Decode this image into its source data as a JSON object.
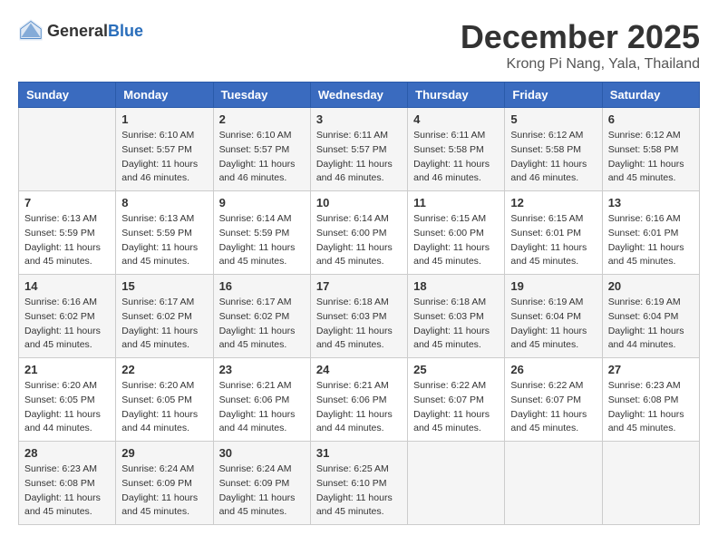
{
  "header": {
    "logo_general": "General",
    "logo_blue": "Blue",
    "month_title": "December 2025",
    "location": "Krong Pi Nang, Yala, Thailand"
  },
  "days_of_week": [
    "Sunday",
    "Monday",
    "Tuesday",
    "Wednesday",
    "Thursday",
    "Friday",
    "Saturday"
  ],
  "weeks": [
    [
      {
        "day": "",
        "info": ""
      },
      {
        "day": "1",
        "info": "Sunrise: 6:10 AM\nSunset: 5:57 PM\nDaylight: 11 hours\nand 46 minutes."
      },
      {
        "day": "2",
        "info": "Sunrise: 6:10 AM\nSunset: 5:57 PM\nDaylight: 11 hours\nand 46 minutes."
      },
      {
        "day": "3",
        "info": "Sunrise: 6:11 AM\nSunset: 5:57 PM\nDaylight: 11 hours\nand 46 minutes."
      },
      {
        "day": "4",
        "info": "Sunrise: 6:11 AM\nSunset: 5:58 PM\nDaylight: 11 hours\nand 46 minutes."
      },
      {
        "day": "5",
        "info": "Sunrise: 6:12 AM\nSunset: 5:58 PM\nDaylight: 11 hours\nand 46 minutes."
      },
      {
        "day": "6",
        "info": "Sunrise: 6:12 AM\nSunset: 5:58 PM\nDaylight: 11 hours\nand 45 minutes."
      }
    ],
    [
      {
        "day": "7",
        "info": "Sunrise: 6:13 AM\nSunset: 5:59 PM\nDaylight: 11 hours\nand 45 minutes."
      },
      {
        "day": "8",
        "info": "Sunrise: 6:13 AM\nSunset: 5:59 PM\nDaylight: 11 hours\nand 45 minutes."
      },
      {
        "day": "9",
        "info": "Sunrise: 6:14 AM\nSunset: 5:59 PM\nDaylight: 11 hours\nand 45 minutes."
      },
      {
        "day": "10",
        "info": "Sunrise: 6:14 AM\nSunset: 6:00 PM\nDaylight: 11 hours\nand 45 minutes."
      },
      {
        "day": "11",
        "info": "Sunrise: 6:15 AM\nSunset: 6:00 PM\nDaylight: 11 hours\nand 45 minutes."
      },
      {
        "day": "12",
        "info": "Sunrise: 6:15 AM\nSunset: 6:01 PM\nDaylight: 11 hours\nand 45 minutes."
      },
      {
        "day": "13",
        "info": "Sunrise: 6:16 AM\nSunset: 6:01 PM\nDaylight: 11 hours\nand 45 minutes."
      }
    ],
    [
      {
        "day": "14",
        "info": "Sunrise: 6:16 AM\nSunset: 6:02 PM\nDaylight: 11 hours\nand 45 minutes."
      },
      {
        "day": "15",
        "info": "Sunrise: 6:17 AM\nSunset: 6:02 PM\nDaylight: 11 hours\nand 45 minutes."
      },
      {
        "day": "16",
        "info": "Sunrise: 6:17 AM\nSunset: 6:02 PM\nDaylight: 11 hours\nand 45 minutes."
      },
      {
        "day": "17",
        "info": "Sunrise: 6:18 AM\nSunset: 6:03 PM\nDaylight: 11 hours\nand 45 minutes."
      },
      {
        "day": "18",
        "info": "Sunrise: 6:18 AM\nSunset: 6:03 PM\nDaylight: 11 hours\nand 45 minutes."
      },
      {
        "day": "19",
        "info": "Sunrise: 6:19 AM\nSunset: 6:04 PM\nDaylight: 11 hours\nand 45 minutes."
      },
      {
        "day": "20",
        "info": "Sunrise: 6:19 AM\nSunset: 6:04 PM\nDaylight: 11 hours\nand 44 minutes."
      }
    ],
    [
      {
        "day": "21",
        "info": "Sunrise: 6:20 AM\nSunset: 6:05 PM\nDaylight: 11 hours\nand 44 minutes."
      },
      {
        "day": "22",
        "info": "Sunrise: 6:20 AM\nSunset: 6:05 PM\nDaylight: 11 hours\nand 44 minutes."
      },
      {
        "day": "23",
        "info": "Sunrise: 6:21 AM\nSunset: 6:06 PM\nDaylight: 11 hours\nand 44 minutes."
      },
      {
        "day": "24",
        "info": "Sunrise: 6:21 AM\nSunset: 6:06 PM\nDaylight: 11 hours\nand 44 minutes."
      },
      {
        "day": "25",
        "info": "Sunrise: 6:22 AM\nSunset: 6:07 PM\nDaylight: 11 hours\nand 45 minutes."
      },
      {
        "day": "26",
        "info": "Sunrise: 6:22 AM\nSunset: 6:07 PM\nDaylight: 11 hours\nand 45 minutes."
      },
      {
        "day": "27",
        "info": "Sunrise: 6:23 AM\nSunset: 6:08 PM\nDaylight: 11 hours\nand 45 minutes."
      }
    ],
    [
      {
        "day": "28",
        "info": "Sunrise: 6:23 AM\nSunset: 6:08 PM\nDaylight: 11 hours\nand 45 minutes."
      },
      {
        "day": "29",
        "info": "Sunrise: 6:24 AM\nSunset: 6:09 PM\nDaylight: 11 hours\nand 45 minutes."
      },
      {
        "day": "30",
        "info": "Sunrise: 6:24 AM\nSunset: 6:09 PM\nDaylight: 11 hours\nand 45 minutes."
      },
      {
        "day": "31",
        "info": "Sunrise: 6:25 AM\nSunset: 6:10 PM\nDaylight: 11 hours\nand 45 minutes."
      },
      {
        "day": "",
        "info": ""
      },
      {
        "day": "",
        "info": ""
      },
      {
        "day": "",
        "info": ""
      }
    ]
  ]
}
